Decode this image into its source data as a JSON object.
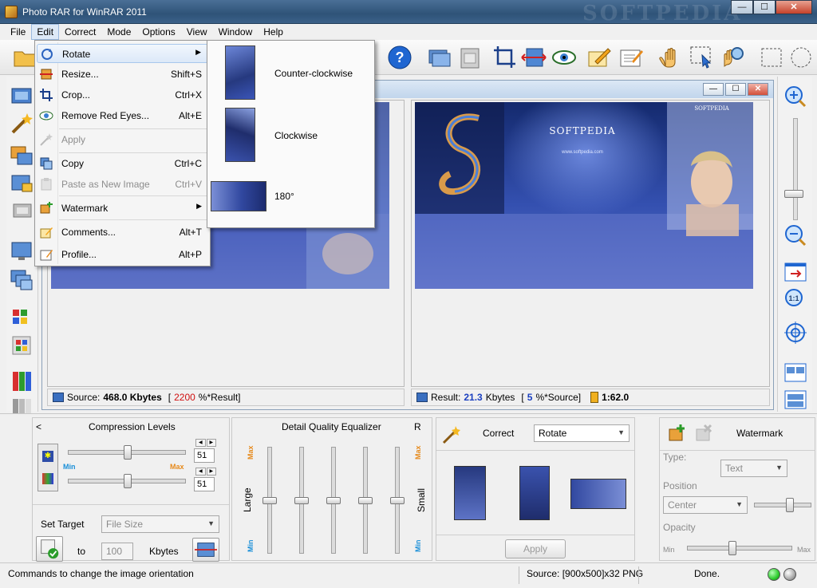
{
  "window": {
    "title": "Photo RAR for WinRAR 2011",
    "watermark": "SOFTPEDIA",
    "min_glyph": "—",
    "max_glyph": "☐",
    "close_glyph": "✕"
  },
  "menubar": {
    "items": [
      "File",
      "Edit",
      "Correct",
      "Mode",
      "Options",
      "View",
      "Window",
      "Help"
    ],
    "active": "Edit"
  },
  "edit_menu": {
    "items": [
      {
        "label": "Rotate",
        "shortcut": "",
        "submenu": true,
        "icon": "rotate-icon",
        "enabled": true
      },
      {
        "label": "Resize...",
        "shortcut": "Shift+S",
        "icon": "resize-icon",
        "enabled": true
      },
      {
        "label": "Crop...",
        "shortcut": "Ctrl+X",
        "icon": "crop-icon",
        "enabled": true
      },
      {
        "label": "Remove Red Eyes...",
        "shortcut": "Alt+E",
        "icon": "eye-icon",
        "enabled": true
      },
      {
        "label": "Apply",
        "shortcut": "",
        "icon": "wand-icon",
        "enabled": false
      },
      {
        "label": "Copy",
        "shortcut": "Ctrl+C",
        "icon": "copy-icon",
        "enabled": true
      },
      {
        "label": "Paste as New Image",
        "shortcut": "Ctrl+V",
        "icon": "paste-icon",
        "enabled": false
      },
      {
        "label": "Watermark",
        "shortcut": "",
        "submenu": true,
        "icon": "watermark-icon",
        "enabled": true
      },
      {
        "label": "Comments...",
        "shortcut": "Alt+T",
        "icon": "comment-icon",
        "enabled": true
      },
      {
        "label": "Profile...",
        "shortcut": "Alt+P",
        "icon": "profile-icon",
        "enabled": true
      }
    ]
  },
  "rotate_submenu": {
    "items": [
      "Counter-clockwise",
      "Clockwise",
      "180°"
    ]
  },
  "child": {
    "min_glyph": "—",
    "max_glyph": "☐",
    "close_glyph": "✕"
  },
  "images": {
    "brand": "SOFTPEDIA",
    "site": "www.softpedia.com"
  },
  "source_info": {
    "label": "Source:",
    "size": "468.0 Kbytes",
    "pct_open": "[",
    "pct": "2200",
    "pct_suffix": "%*Result]"
  },
  "result_info": {
    "label": "Result:",
    "size": "21.3",
    "unit": "Kbytes",
    "pct_open": "[",
    "pct": "5",
    "pct_suffix": "%*Source]",
    "ratio": "1:62.0"
  },
  "compression": {
    "title": "Compression Levels",
    "collapse": "<",
    "value1": "51",
    "value2": "51",
    "level1": 0.51,
    "level2": 0.51,
    "min_label": "Min",
    "max_label": "Max",
    "set_target": "Set Target",
    "target_type": "File Size",
    "to_label": "to",
    "target_value": "100",
    "unit": "Kbytes"
  },
  "equalizer": {
    "title": "Detail Quality Equalizer",
    "r_label": "R",
    "max_label": "Max",
    "min_label": "Min",
    "large_label": "Large",
    "small_label": "Small",
    "levels": [
      0.5,
      0.5,
      0.5,
      0.5,
      0.5
    ]
  },
  "correct": {
    "title": "Correct",
    "mode": "Rotate",
    "apply": "Apply"
  },
  "watermark": {
    "title": "Watermark",
    "type_label": "Type:",
    "type_value": "Text",
    "position_label": "Position",
    "position_value": "Center",
    "opacity_label": "Opacity",
    "min_label": "Min",
    "max_label": "Max",
    "opacity_level": 0.43
  },
  "status": {
    "hint": "Commands to change the image orientation",
    "source": "Source: [900x500]x32 PNG",
    "state": "Done."
  },
  "colors": {
    "accent": "#1a3fc0",
    "warn": "#d01010",
    "led_green": "#2ecc2e"
  }
}
